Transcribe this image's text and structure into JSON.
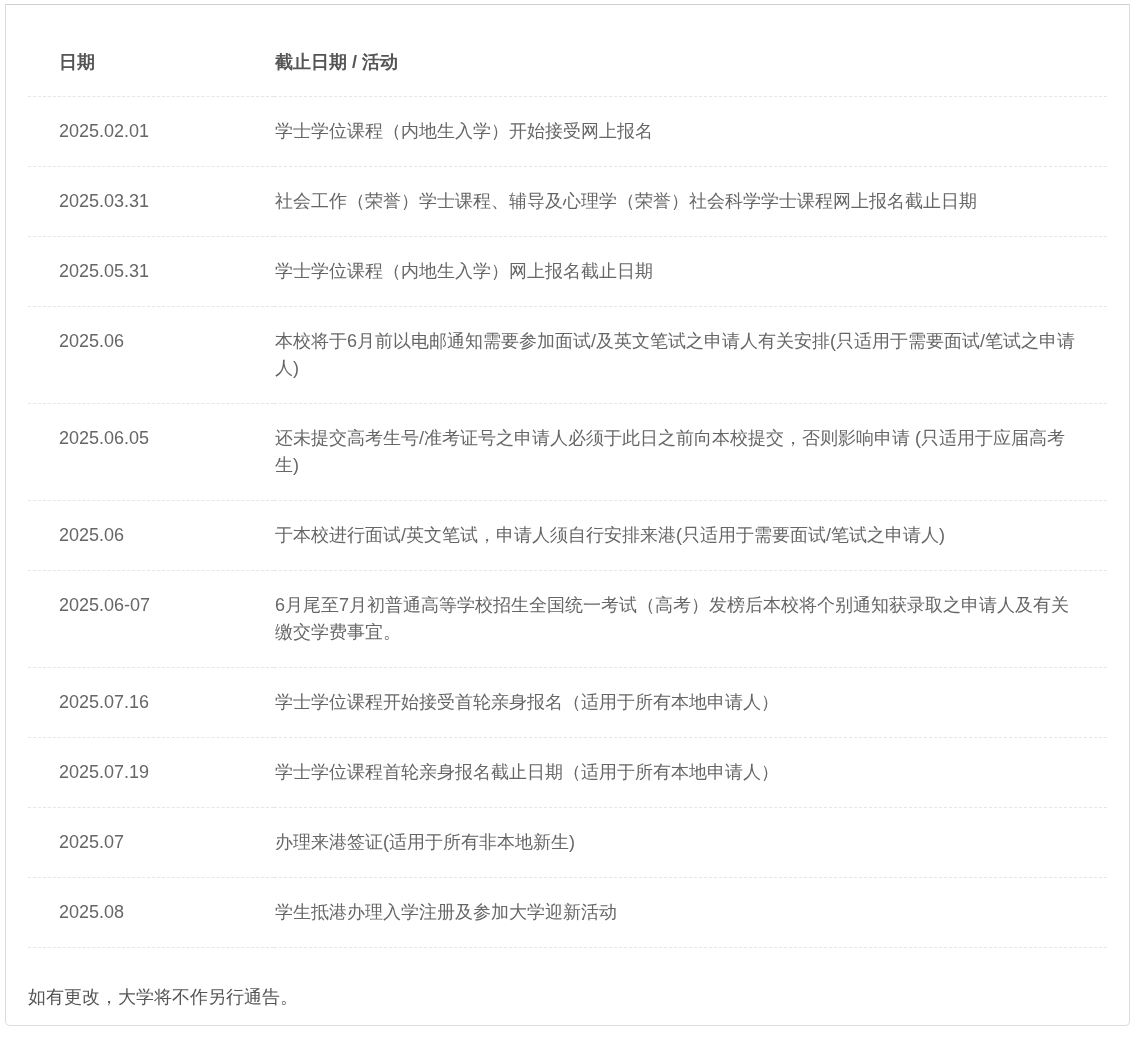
{
  "table": {
    "columns": [
      "日期",
      "截止日期 / 活动"
    ],
    "rows": [
      {
        "date": "2025.02.01",
        "activity": "学士学位课程（内地生入学）开始接受网上报名"
      },
      {
        "date": "2025.03.31",
        "activity": "社会工作（荣誉）学士课程、辅导及心理学（荣誉）社会科学学士课程网上报名截止日期"
      },
      {
        "date": "2025.05.31",
        "activity": "学士学位课程（内地生入学）网上报名截止日期"
      },
      {
        "date": "2025.06",
        "activity": "本校将于6月前以电邮通知需要参加面试/及英文笔试之申请人有关安排(只适用于需要面试/笔试之申请人)"
      },
      {
        "date": "2025.06.05",
        "activity": "还未提交高考生号/准考证号之申请人必须于此日之前向本校提交，否则影响申请 (只适用于应届高考生)"
      },
      {
        "date": "2025.06",
        "activity": "于本校进行面试/英文笔试，申请人须自行安排来港(只适用于需要面试/笔试之申请人)"
      },
      {
        "date": "2025.06-07",
        "activity": "6月尾至7月初普通高等学校招生全国统一考试（高考）发榜后本校将个别通知获录取之申请人及有关缴交学费事宜。"
      },
      {
        "date": "2025.07.16",
        "activity": "学士学位课程开始接受首轮亲身报名（适用于所有本地申请人）"
      },
      {
        "date": "2025.07.19",
        "activity": "学士学位课程首轮亲身报名截止日期（适用于所有本地申请人）"
      },
      {
        "date": "2025.07",
        "activity": "办理来港签证(适用于所有非本地新生)"
      },
      {
        "date": "2025.08",
        "activity": "学生抵港办理入学注册及参加大学迎新活动"
      }
    ]
  },
  "note": "如有更改，大学将不作另行通告。"
}
